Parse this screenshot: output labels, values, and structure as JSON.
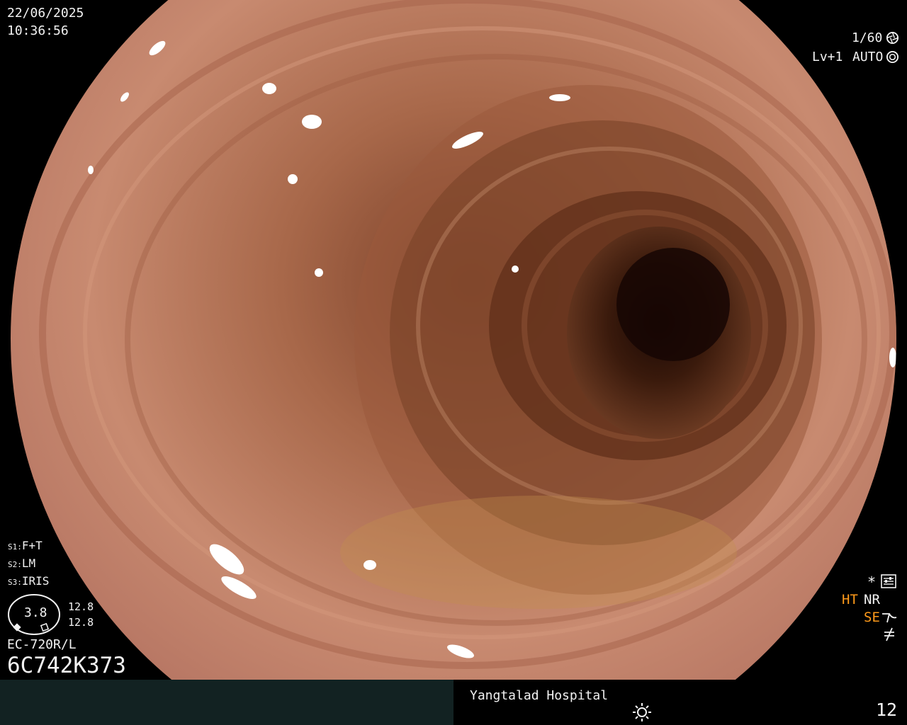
{
  "overlay": {
    "date": "22/06/2025",
    "time": "10:36:56",
    "shutter": "1/60",
    "level": "Lv+1",
    "iris_mode": "AUTO",
    "s1": "F+T",
    "s2": "LM",
    "s3": "IRIS",
    "s1_label": "S1:",
    "s2_label": "S2:",
    "s3_label": "S3:",
    "gauge_value": "3.8",
    "gauge_top": "12.8",
    "gauge_bottom": "12.8",
    "scope_model": "EC-720R/L",
    "serial": "6C742K373",
    "ht": "HT",
    "nr": "NR",
    "se": "SE",
    "hospital": "Yangtalad Hospital",
    "image_number": "12"
  },
  "icons": {
    "shutter": "aperture-icon",
    "iris": "iris-icon",
    "star": "asterisk-icon",
    "settings": "settings-icon",
    "enhance": "enhance-curve-icon",
    "filter": "filter-icon",
    "brightness": "brightness-icon"
  },
  "colors": {
    "mucosa": "#c98a70",
    "lumen": "#2a1208",
    "ht_se": "#ff9a1a",
    "bottom_bar_left": "#122222"
  }
}
